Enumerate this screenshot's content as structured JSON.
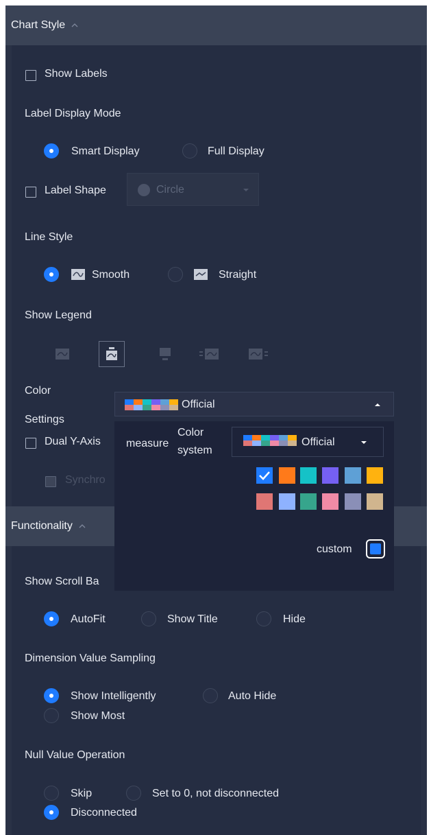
{
  "sections": {
    "chart_style": {
      "title": "Chart Style"
    },
    "functionality": {
      "title": "Functionality"
    }
  },
  "chart_style": {
    "show_labels": {
      "label": "Show Labels",
      "checked": false
    },
    "label_display_mode": {
      "title": "Label Display Mode",
      "options": [
        "Smart Display",
        "Full Display"
      ],
      "selected": "Smart Display"
    },
    "label_shape": {
      "label": "Label Shape",
      "value": "Circle",
      "checked": false
    },
    "line_style": {
      "title": "Line Style",
      "options": [
        "Smooth",
        "Straight"
      ],
      "selected": "Smooth"
    },
    "show_legend": {
      "title": "Show Legend",
      "selected_index": 1
    },
    "color": {
      "label": "Color",
      "value": "Official"
    },
    "settings": {
      "label": "Settings",
      "dual_y_axis": "Dual Y-Axis",
      "sync_partial": "Synchro"
    }
  },
  "color_panel": {
    "measure_label": "measure",
    "color_system_line1": "Color",
    "color_system_line2": "system",
    "system_value": "Official",
    "custom_label": "custom",
    "palette": [
      "#1f7bff",
      "#ff7a1a",
      "#15c2c7",
      "#7560f2",
      "#5ea0d6",
      "#ffb20f",
      "#e07674",
      "#8eb2ff",
      "#36a58c",
      "#f08aa6",
      "#8a8fb7",
      "#d0b58e"
    ],
    "custom_color": "#1f7bff"
  },
  "functionality": {
    "scroll_bar": {
      "title": "Show Scroll Ba",
      "options": [
        "AutoFit",
        "Show Title",
        "Hide"
      ],
      "selected": "AutoFit"
    },
    "dimension_sampling": {
      "title": "Dimension Value Sampling",
      "options": [
        "Show Intelligently",
        "Auto Hide",
        "Show Most"
      ],
      "selected": "Show Intelligently"
    },
    "null_value": {
      "title": "Null Value Operation",
      "options": [
        "Skip",
        "Set to 0, not disconnected",
        "Disconnected"
      ],
      "selected": "Disconnected"
    }
  },
  "colors": {
    "accent": "#1f7bff",
    "panel_bg": "#252d42",
    "header_bg": "#3a4356",
    "popup_bg": "#1d2339"
  }
}
